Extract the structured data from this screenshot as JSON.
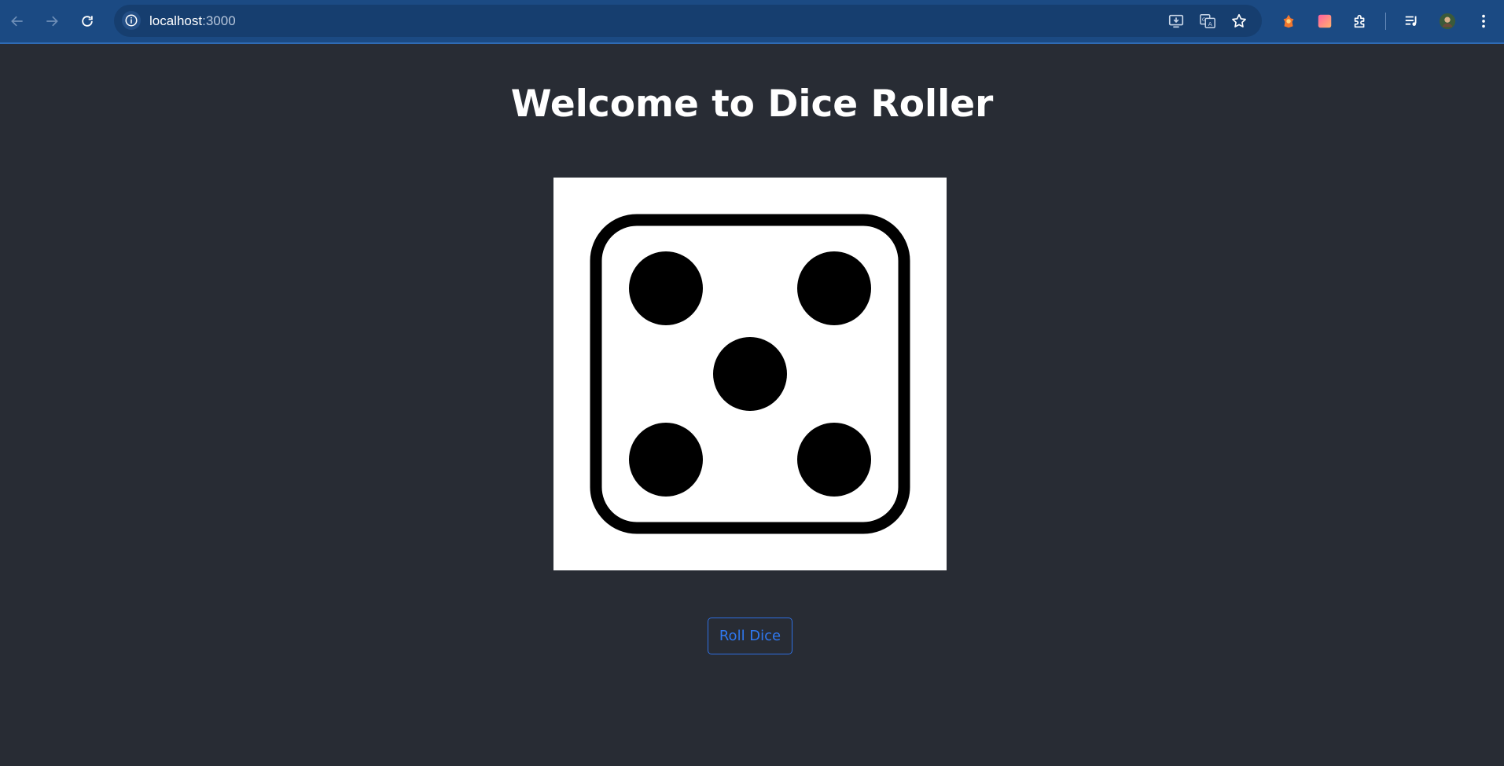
{
  "browser": {
    "url_host": "localhost",
    "url_port": ":3000",
    "icons": {
      "back": "arrow-left-icon",
      "forward": "arrow-right-icon",
      "reload": "reload-icon",
      "site_info": "info-icon",
      "install": "install-app-icon",
      "translate": "translate-icon",
      "bookmark": "star-icon",
      "extension1": "extension-fox-icon",
      "extension2": "extension-gradient-icon",
      "extensions": "puzzle-icon",
      "media": "media-control-icon",
      "profile": "avatar",
      "menu": "kebab-menu-icon"
    }
  },
  "page": {
    "title": "Welcome to Dice Roller",
    "dice_value": 5,
    "roll_button_label": "Roll Dice"
  },
  "colors": {
    "background": "#282c34",
    "chrome": "#1b4a83",
    "accent": "#2f78f0"
  }
}
